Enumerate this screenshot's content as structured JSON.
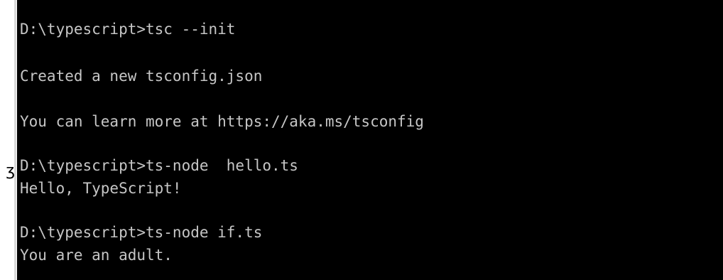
{
  "terminal": {
    "left_glyph": "ʒ",
    "lines": [
      "D:\\typescript>tsc --init",
      "Created a new tsconfig.json",
      "You can learn more at https://aka.ms/tsconfig",
      "D:\\typescript>ts-node  hello.ts",
      "Hello, TypeScript!",
      "D:\\typescript>ts-node if.ts",
      "You are an adult."
    ]
  }
}
